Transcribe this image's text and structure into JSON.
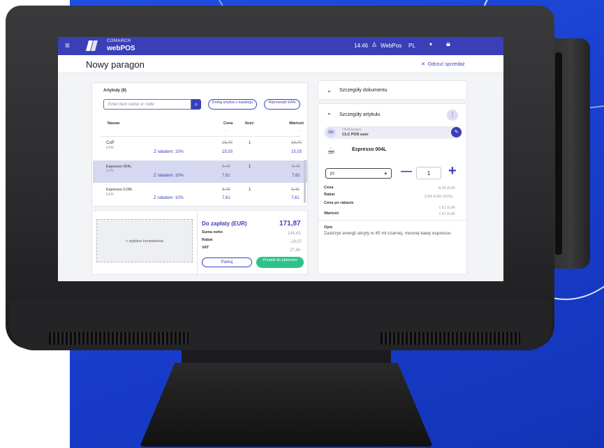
{
  "app": {
    "brand_top": "COMARCH",
    "brand_bottom": "webPOS",
    "time": "14:46",
    "user": "WebPos",
    "language": "PL",
    "page_title": "Nowy paragon",
    "cancel_sale": "Odrzuć sprzedaż"
  },
  "articles": {
    "title": "Artykuły (8)",
    "search_placeholder": "Enter item name or code",
    "add_from_catalog": "Dodaj artykuł z katalogu",
    "enter_ean": "Wprowadź EAN",
    "columns": {
      "name": "Nazwa",
      "price": "Cena",
      "qty": "Ilość",
      "value": "Wartość"
    },
    "dash_price": "-",
    "dash_value": "-",
    "rows": [
      {
        "name": "CuP",
        "ean": "EAN:",
        "price_old": "16,70",
        "qty": "1",
        "value_old": "16,70",
        "discount_label": "Z rabatem: 10%",
        "price_new": "15,03",
        "value_new": "15,03"
      },
      {
        "name": "Espresso 004L",
        "ean": "EAN:",
        "price_old": "8,45",
        "qty": "1",
        "value_old": "8,45",
        "discount_label": "Z rabatem: 10%",
        "price_new": "7,61",
        "value_new": "7,61"
      },
      {
        "name": "Espresso 0,08L",
        "ean": "EAN:",
        "price_old": "8,45",
        "qty": "1",
        "value_old": "8,45",
        "discount_label": "Z rabatem: 10%",
        "price_new": "7,61",
        "value_new": "7,61"
      }
    ]
  },
  "payment": {
    "choose_buyer": "+ wybierz kontrahenta",
    "due_label": "Do zapłaty (EUR)",
    "due_value": "171,87",
    "net_label": "Suma netto",
    "net_value": "144,43",
    "discount_label": "Rabat",
    "discount_value": "-19,07",
    "vat_label": "VAT",
    "vat_value": "27,44",
    "park": "Parkuj",
    "go_to_payment": "Przejdź do płatności"
  },
  "document": {
    "title": "Szczegóły dokumentu"
  },
  "item": {
    "title": "Szczegóły artykułu",
    "cashier_initials": "CU",
    "cashier_role": "Obsługujący",
    "cashier_name": "CLC POS user",
    "name": "Espresso 004L",
    "unit": "pc",
    "quantity": "1",
    "price_label": "Cena",
    "price_value": "8,45 EUR",
    "discount_label": "Rabat",
    "discount_value": "0,84 EUR (10%)",
    "after_discount_label": "Cena po rabacie",
    "after_discount_value": "7,61 EUR",
    "value_label": "Wartość",
    "value_value": "7,61 EUR",
    "desc_label": "Opis",
    "description": "Zastrzyk energii ukryty w 40 ml czarnej, mocnej kawy espresso."
  },
  "colors": {
    "accent": "#3a3fb8",
    "pay": "#2ec28a",
    "selection": "#d6d7f0",
    "background_blue": "#1f4fe0"
  }
}
